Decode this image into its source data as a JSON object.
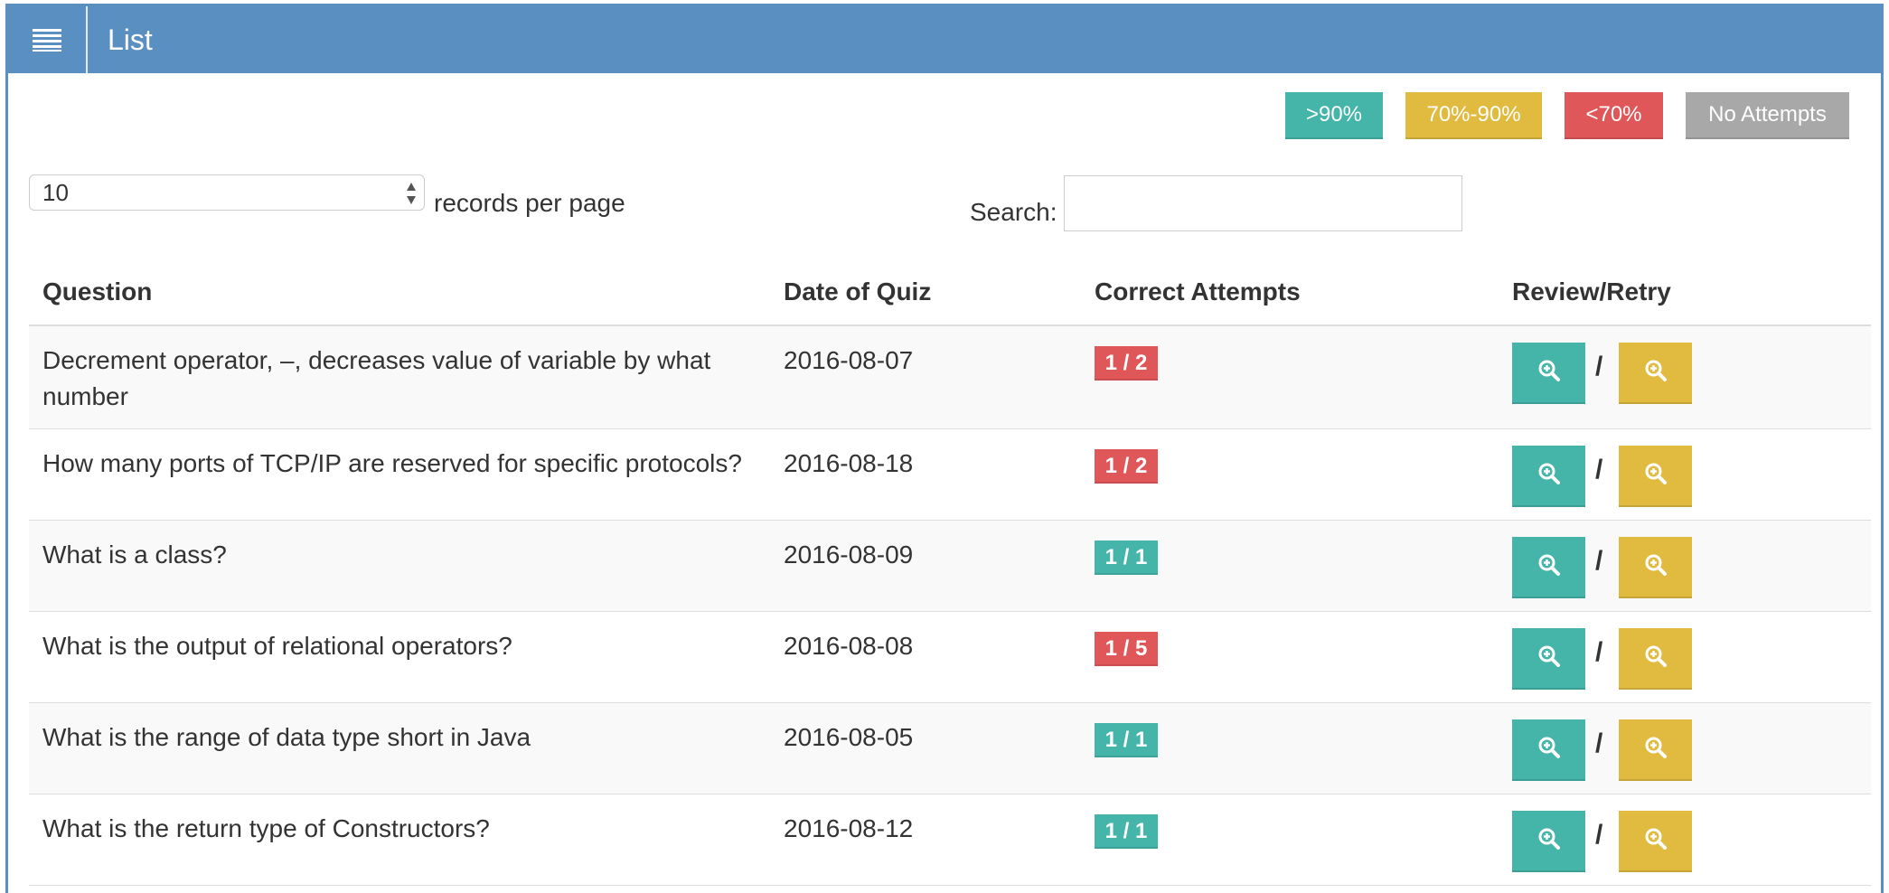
{
  "header": {
    "title": "List",
    "menu_icon": "hamburger-menu-icon"
  },
  "legend": [
    {
      "label": ">90%",
      "color": "#45b5aa"
    },
    {
      "label": "70%-90%",
      "color": "#e1bb40"
    },
    {
      "label": "<70%",
      "color": "#e0575a"
    },
    {
      "label": "No Attempts",
      "color": "#a8a8a8"
    }
  ],
  "controls": {
    "page_length_value": "10",
    "page_length_label": "records per page",
    "search_label": "Search:",
    "search_value": ""
  },
  "table": {
    "columns": [
      "Question",
      "Date of Quiz",
      "Correct Attempts",
      "Review/Retry"
    ],
    "separator": "/",
    "action_icon": "zoom-in-icon",
    "rows": [
      {
        "question": "Decrement operator, –, decreases value of variable by what number",
        "date": "2016-08-07",
        "attempts": "1 / 2",
        "status": "red"
      },
      {
        "question": "How many ports of TCP/IP are reserved for specific protocols?",
        "date": "2016-08-18",
        "attempts": "1 / 2",
        "status": "red"
      },
      {
        "question": "What is a class?",
        "date": "2016-08-09",
        "attempts": "1 / 1",
        "status": "teal"
      },
      {
        "question": "What is the output of relational operators?",
        "date": "2016-08-08",
        "attempts": "1 / 5",
        "status": "red"
      },
      {
        "question": "What is the range of data type short in Java",
        "date": "2016-08-05",
        "attempts": "1 / 1",
        "status": "teal"
      },
      {
        "question": "What is the return type of Constructors?",
        "date": "2016-08-12",
        "attempts": "1 / 1",
        "status": "teal"
      }
    ]
  }
}
